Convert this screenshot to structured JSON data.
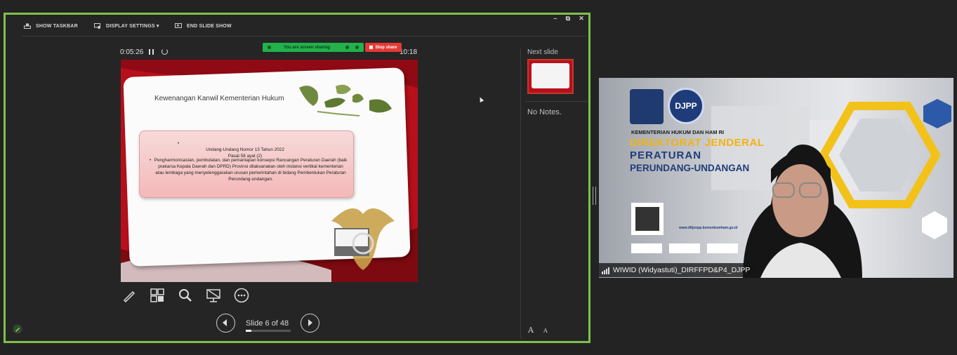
{
  "toolbar": {
    "show_taskbar": "SHOW TASKBAR",
    "display_settings": "DISPLAY SETTINGS ▾",
    "end_slide_show": "END SLIDE SHOW",
    "minimize": "–",
    "restore": "⧉",
    "close": "✕"
  },
  "presenter": {
    "elapsed_time": "0:05:26",
    "clock": "10:18",
    "next_slide_label": "Next slide",
    "notes": "No Notes.",
    "slide_counter": "Slide 6 of 48",
    "slide_progress": 0.125,
    "font_increase": "A",
    "font_decrease": "A"
  },
  "screen_share": {
    "status": "You are screen sharing",
    "stop_label": "Stop share",
    "color": "#22b14c",
    "stop_color": "#e43a35"
  },
  "slide": {
    "title": "Kewenangan Kanwil Kementerian Hukum",
    "bullet1": "Undang-Undang  Nomor 13 Tahun 2022\nPasal 58 ayat (2)",
    "bullet2": "Pengharmonisasian, pembulatan, dan pemantapan konsepsi Rancangan Peraturan Daerah (baik prakarsa Kepala Daerah dan DPRD) Provinsi dilaksanakan oleh instansi vertikal kementerian atau lembaga yang menyelenggarakan urusan pemerintahan di bidang Pembentukan Peraturan Perundang-undangan.",
    "bullet_mark": "•",
    "accent": "#b8101b"
  },
  "tools": [
    "pen-icon",
    "grid-view-icon",
    "zoom-icon",
    "black-screen-icon",
    "more-options-icon"
  ],
  "video": {
    "participant_name": "WIWID (Widyastuti)_DIRFFPD&P4_DJPP",
    "line1": "KEMENTERIAN HUKUM DAN HAM RI",
    "line2": "DIREKTORAT JENDERAL",
    "line3": "PERATURAN",
    "line4": "PERUNDANG-UNDANGAN",
    "logo_text": "DJPP",
    "url": "www.ditjenpp.kemenkumham.go.id"
  }
}
